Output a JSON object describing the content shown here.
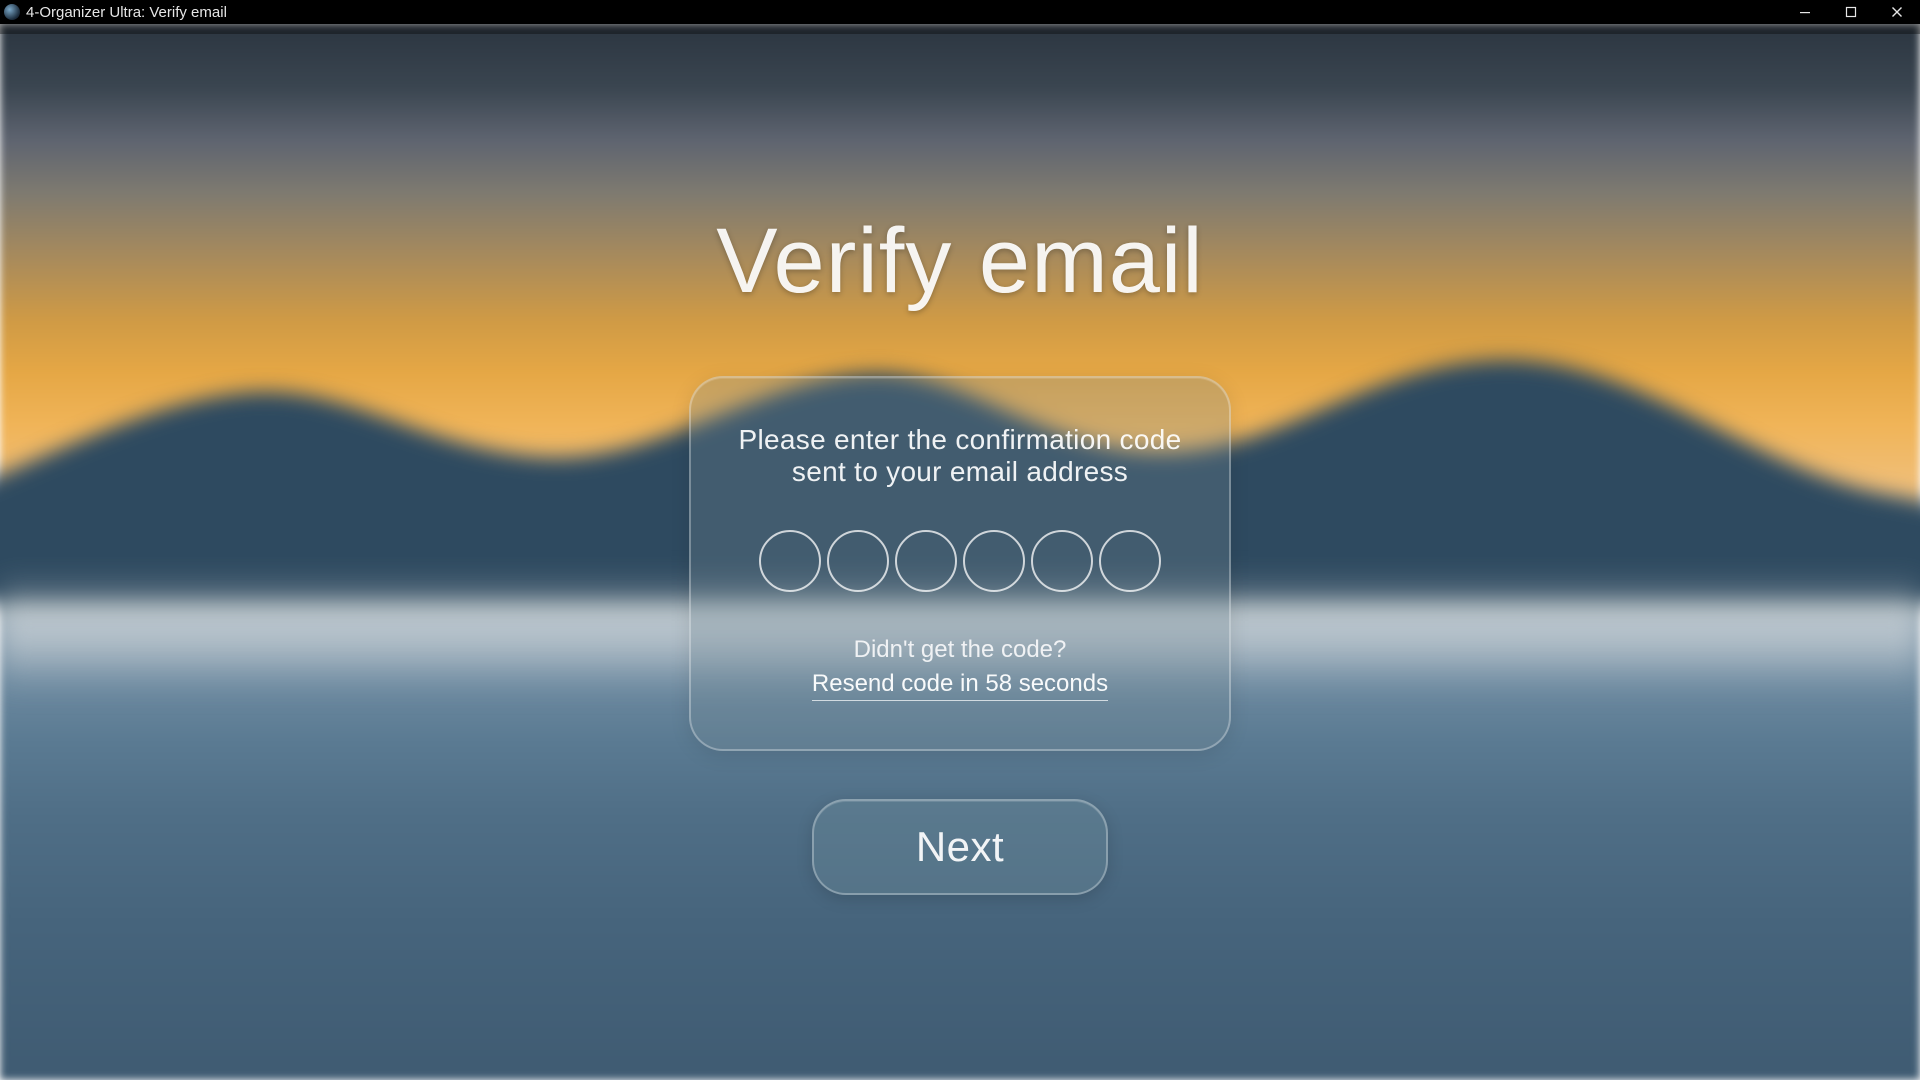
{
  "window": {
    "title": "4-Organizer Ultra: Verify email"
  },
  "page": {
    "heading": "Verify email"
  },
  "card": {
    "instruction_line1": "Please enter the confirmation code",
    "instruction_line2": "sent to your email address",
    "code_digits": [
      "",
      "",
      "",
      "",
      "",
      ""
    ],
    "didnt_get_label": "Didn't get the code?",
    "resend_label": "Resend code in 58 seconds",
    "resend_seconds_remaining": 58
  },
  "actions": {
    "next_label": "Next"
  },
  "colors": {
    "text_light": "#ebf1f4",
    "panel_border": "rgba(255,255,255,0.30)"
  }
}
